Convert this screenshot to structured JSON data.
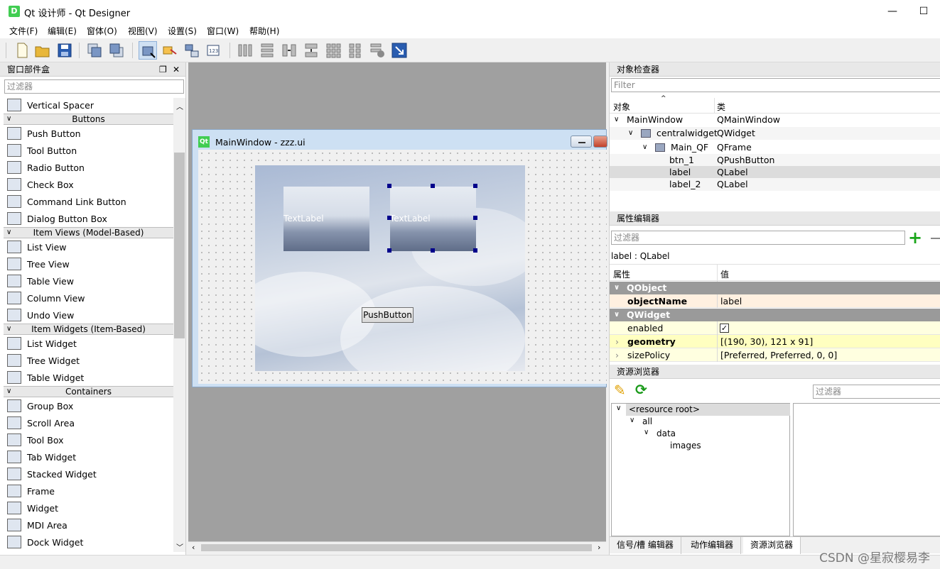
{
  "window": {
    "title": "Qt 设计师 - Qt Designer",
    "app_icon": "D"
  },
  "menu": [
    "文件(F)",
    "编辑(E)",
    "窗体(O)",
    "视图(V)",
    "设置(S)",
    "窗口(W)",
    "帮助(H)"
  ],
  "widget_box": {
    "title": "窗口部件盒",
    "filter_placeholder": "过滤器",
    "entries": [
      {
        "kind": "item",
        "label": "Vertical Spacer",
        "icon": "vertical-spacer-icon"
      },
      {
        "kind": "cat",
        "label": "Buttons"
      },
      {
        "kind": "item",
        "label": "Push Button",
        "icon": "push-button-icon"
      },
      {
        "kind": "item",
        "label": "Tool Button",
        "icon": "tool-button-icon"
      },
      {
        "kind": "item",
        "label": "Radio Button",
        "icon": "radio-button-icon"
      },
      {
        "kind": "item",
        "label": "Check Box",
        "icon": "check-box-icon"
      },
      {
        "kind": "item",
        "label": "Command Link Button",
        "icon": "command-link-icon"
      },
      {
        "kind": "item",
        "label": "Dialog Button Box",
        "icon": "dialog-button-box-icon"
      },
      {
        "kind": "cat",
        "label": "Item Views (Model-Based)"
      },
      {
        "kind": "item",
        "label": "List View",
        "icon": "list-view-icon"
      },
      {
        "kind": "item",
        "label": "Tree View",
        "icon": "tree-view-icon"
      },
      {
        "kind": "item",
        "label": "Table View",
        "icon": "table-view-icon"
      },
      {
        "kind": "item",
        "label": "Column View",
        "icon": "column-view-icon"
      },
      {
        "kind": "item",
        "label": "Undo View",
        "icon": "undo-view-icon"
      },
      {
        "kind": "cat",
        "label": "Item Widgets (Item-Based)"
      },
      {
        "kind": "item",
        "label": "List Widget",
        "icon": "list-widget-icon"
      },
      {
        "kind": "item",
        "label": "Tree Widget",
        "icon": "tree-widget-icon"
      },
      {
        "kind": "item",
        "label": "Table Widget",
        "icon": "table-widget-icon"
      },
      {
        "kind": "cat",
        "label": "Containers"
      },
      {
        "kind": "item",
        "label": "Group Box",
        "icon": "group-box-icon"
      },
      {
        "kind": "item",
        "label": "Scroll Area",
        "icon": "scroll-area-icon"
      },
      {
        "kind": "item",
        "label": "Tool Box",
        "icon": "tool-box-icon"
      },
      {
        "kind": "item",
        "label": "Tab Widget",
        "icon": "tab-widget-icon"
      },
      {
        "kind": "item",
        "label": "Stacked Widget",
        "icon": "stacked-widget-icon"
      },
      {
        "kind": "item",
        "label": "Frame",
        "icon": "frame-icon"
      },
      {
        "kind": "item",
        "label": "Widget",
        "icon": "widget-icon"
      },
      {
        "kind": "item",
        "label": "MDI Area",
        "icon": "mdi-area-icon"
      },
      {
        "kind": "item",
        "label": "Dock Widget",
        "icon": "dock-widget-icon"
      }
    ]
  },
  "form": {
    "title": "MainWindow - zzz.ui",
    "icon": "Qt",
    "label1_text": "TextLabel",
    "label2_text": "TextLabel",
    "button_text": "PushButton"
  },
  "object_inspector": {
    "title": "对象检查器",
    "filter_placeholder": "Filter",
    "col_object": "对象",
    "col_class": "类",
    "rows": [
      {
        "name": "MainWindow",
        "cls": "QMainWindow"
      },
      {
        "name": "centralwidget",
        "cls": "QWidget"
      },
      {
        "name": "Main_QF",
        "cls": "QFrame"
      },
      {
        "name": "btn_1",
        "cls": "QPushButton"
      },
      {
        "name": "label",
        "cls": "QLabel"
      },
      {
        "name": "label_2",
        "cls": "QLabel"
      }
    ]
  },
  "property_editor": {
    "title": "属性编辑器",
    "filter_placeholder": "过滤器",
    "subject": "label : QLabel",
    "col_prop": "属性",
    "col_value": "值",
    "group1": "QObject",
    "objectName_label": "objectName",
    "objectName_value": "label",
    "group2": "QWidget",
    "enabled_label": "enabled",
    "geometry_label": "geometry",
    "geometry_value": "[(190, 30), 121 x 91]",
    "sizePolicy_label": "sizePolicy",
    "sizePolicy_value": "[Preferred, Preferred, 0, 0]"
  },
  "resource_browser": {
    "title": "资源浏览器",
    "filter_placeholder": "过滤器",
    "root": "<resource root>",
    "all": "all",
    "data": "data",
    "images": "images"
  },
  "tabs": [
    "信号/槽 编辑器",
    "动作编辑器",
    "资源浏览器"
  ],
  "watermark": "CSDN @星寂樱易李"
}
